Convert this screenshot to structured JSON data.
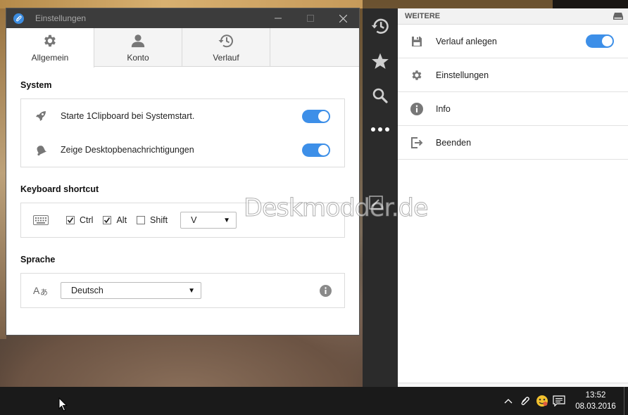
{
  "settings_window": {
    "title": "Einstellungen",
    "tabs": [
      {
        "label": "Allgemein",
        "icon": "gear-icon",
        "active": true
      },
      {
        "label": "Konto",
        "icon": "user-icon",
        "active": false
      },
      {
        "label": "Verlauf",
        "icon": "history-icon",
        "active": false
      }
    ],
    "system": {
      "heading": "System",
      "startup_label": "Starte 1Clipboard bei Systemstart.",
      "startup_on": true,
      "notifications_label": "Zeige Desktopbenachrichtigungen",
      "notifications_on": true
    },
    "shortcut": {
      "heading": "Keyboard shortcut",
      "ctrl_label": "Ctrl",
      "ctrl_checked": true,
      "alt_label": "Alt",
      "alt_checked": true,
      "shift_label": "Shift",
      "shift_checked": false,
      "key_value": "V"
    },
    "language": {
      "heading": "Sprache",
      "value": "Deutsch"
    }
  },
  "side_panel": {
    "header": "WEITERE",
    "items": [
      {
        "label": "Verlauf anlegen",
        "icon": "save-icon",
        "toggle_on": true
      },
      {
        "label": "Einstellungen",
        "icon": "gear-icon"
      },
      {
        "label": "Info",
        "icon": "info-icon"
      },
      {
        "label": "Beenden",
        "icon": "exit-icon"
      }
    ],
    "nav_icons": [
      "history-icon",
      "star-icon",
      "search-icon",
      "more-icon"
    ]
  },
  "watermark": "Deskmodder.de",
  "taskbar": {
    "time": "13:52",
    "date": "08.03.2016"
  },
  "colors": {
    "accent": "#3d8fe8",
    "titlebar": "#3c3c3c",
    "nav_dark": "#2b2b2b",
    "taskbar": "#1a1a1a"
  }
}
